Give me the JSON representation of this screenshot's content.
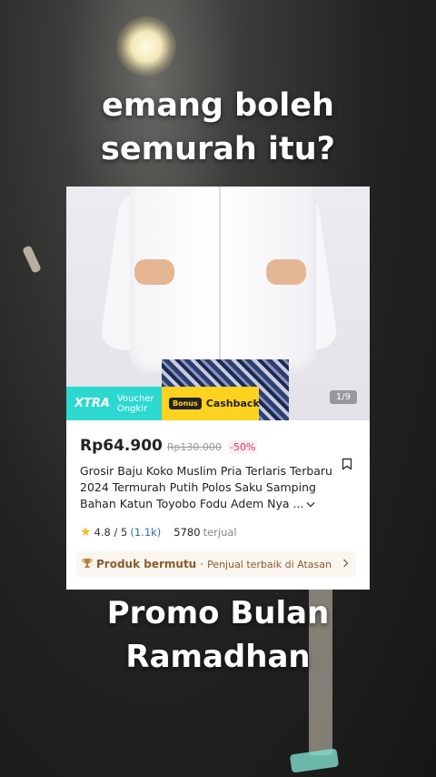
{
  "caption_top": [
    "emang boleh",
    "semurah itu?"
  ],
  "caption_bottom": [
    "Promo Bulan",
    "Ramadhan"
  ],
  "product": {
    "badges": {
      "xtra_logo": "XTRA",
      "xtra_line1": "Voucher",
      "xtra_line2": "Ongkir",
      "bonus_pill": "Bonus",
      "bonus_text": "Cashback"
    },
    "image_counter": "1/9",
    "price": "Rp64.900",
    "original_price": "Rp130.000",
    "discount": "-50%",
    "title": "Grosir Baju Koko Muslim Pria Terlaris Terbaru 2024 Termurah Putih Polos Saku Samping Bahan Katun Toyobo Fodu Adem Nya ...",
    "rating": "4.8 / 5",
    "rating_count": "(1.1k)",
    "sold_count": "5780",
    "sold_label": "terjual",
    "quality_title": "Produk bermutu",
    "quality_separator": "·",
    "quality_subtitle": "Penjual terbaik di Atasan"
  },
  "colors": {
    "xtra": "#2dd8d0",
    "bonus": "#ffd21f",
    "discount": "#ee2b55",
    "quality_text": "#8a5b2b"
  },
  "icons": [
    "star-icon",
    "bookmark-icon",
    "trophy-icon",
    "chevron-right-icon",
    "chevron-down-icon"
  ]
}
